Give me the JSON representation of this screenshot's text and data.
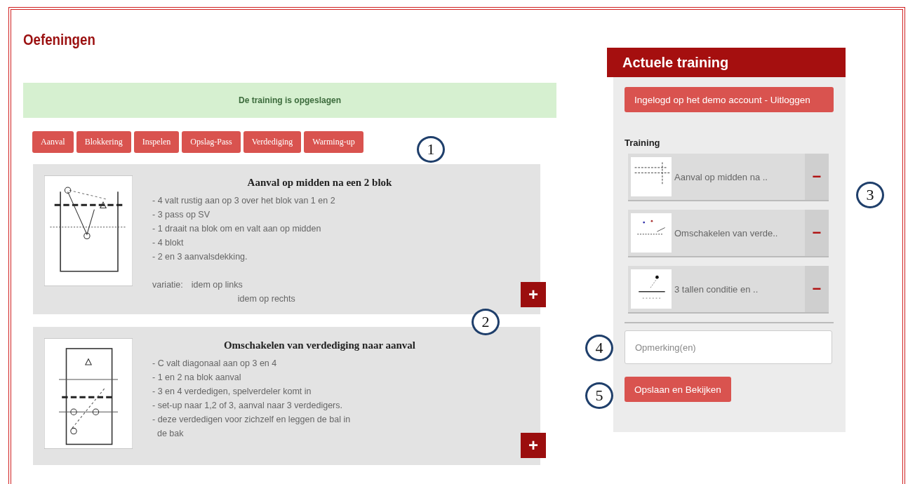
{
  "page": {
    "title": "Oefeningen"
  },
  "alert": {
    "text": "De training is opgeslagen"
  },
  "categories": [
    {
      "label": "Aanval"
    },
    {
      "label": "Blokkering"
    },
    {
      "label": "Inspelen"
    },
    {
      "label": "Opslag-Pass"
    },
    {
      "label": "Verdediging"
    },
    {
      "label": "Warming-up"
    }
  ],
  "exercises": [
    {
      "title": "Aanval op midden na een 2 blok",
      "lines": [
        "- 4 valt rustig aan op 3 over het blok van 1 en 2",
        "- 3 pass op SV",
        "- 1 draait na blok om en valt aan op midden",
        "- 4 blokt",
        "- 2 en 3 aanvalsdekking."
      ],
      "variation_label": "variatie:",
      "variations": [
        "idem op links",
        "idem op rechts"
      ],
      "add_button": "+"
    },
    {
      "title": "Omschakelen van verdediging naar aanval",
      "lines": [
        "- C valt diagonaal aan op 3 en 4",
        "- 1 en 2 na blok aanval",
        "- 3 en 4 verdedigen, spelverdeler komt in",
        "- set-up naar 1,2 of 3, aanval naar 3 verdedigers.",
        "- deze verdedigen voor zichzelf en leggen de bal in",
        "  de bak"
      ],
      "add_button": "+"
    }
  ],
  "sidebar": {
    "title": "Actuele training",
    "login_button": "Ingelogd op het demo account - Uitloggen",
    "training_label": "Training",
    "items": [
      {
        "title": "Aanval op midden na ..",
        "remove_button": "−"
      },
      {
        "title": "Omschakelen van verde..",
        "remove_button": "−"
      },
      {
        "title": "3 tallen conditie en ..",
        "remove_button": "−"
      }
    ],
    "remarks_field": {
      "placeholder": "Opmerking(en)"
    },
    "save_button": "Opslaan en Bekijken"
  },
  "callouts": [
    {
      "label": "1"
    },
    {
      "label": "2"
    },
    {
      "label": "3"
    },
    {
      "label": "4"
    },
    {
      "label": "5"
    }
  ]
}
